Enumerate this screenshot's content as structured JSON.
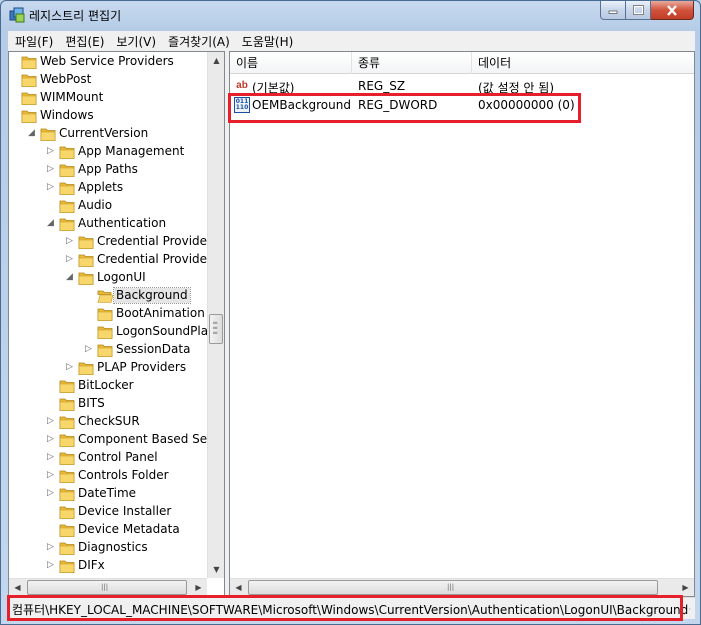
{
  "window": {
    "title": "레지스트리 편집기"
  },
  "menu": [
    "파일(F)",
    "편집(E)",
    "보기(V)",
    "즐겨찾기(A)",
    "도움말(H)"
  ],
  "tree": [
    {
      "label": "Web Service Providers",
      "indent": 0,
      "expander": "none",
      "selected": false
    },
    {
      "label": "WebPost",
      "indent": 0,
      "expander": "none",
      "selected": false
    },
    {
      "label": "WIMMount",
      "indent": 0,
      "expander": "none",
      "selected": false
    },
    {
      "label": "Windows",
      "indent": 0,
      "expander": "none",
      "selected": false
    },
    {
      "label": "CurrentVersion",
      "indent": 1,
      "expander": "open",
      "selected": false
    },
    {
      "label": "App Management",
      "indent": 2,
      "expander": "closed",
      "selected": false
    },
    {
      "label": "App Paths",
      "indent": 2,
      "expander": "closed",
      "selected": false
    },
    {
      "label": "Applets",
      "indent": 2,
      "expander": "closed",
      "selected": false
    },
    {
      "label": "Audio",
      "indent": 2,
      "expander": "none",
      "selected": false
    },
    {
      "label": "Authentication",
      "indent": 2,
      "expander": "open",
      "selected": false
    },
    {
      "label": "Credential Provider Fi",
      "indent": 3,
      "expander": "closed",
      "selected": false
    },
    {
      "label": "Credential Providers",
      "indent": 3,
      "expander": "closed",
      "selected": false
    },
    {
      "label": "LogonUI",
      "indent": 3,
      "expander": "open",
      "selected": false
    },
    {
      "label": "Background",
      "indent": 4,
      "expander": "none",
      "selected": true
    },
    {
      "label": "BootAnimation",
      "indent": 4,
      "expander": "none",
      "selected": false
    },
    {
      "label": "LogonSoundPlaye",
      "indent": 4,
      "expander": "none",
      "selected": false
    },
    {
      "label": "SessionData",
      "indent": 4,
      "expander": "closed",
      "selected": false
    },
    {
      "label": "PLAP Providers",
      "indent": 3,
      "expander": "closed",
      "selected": false
    },
    {
      "label": "BitLocker",
      "indent": 2,
      "expander": "none",
      "selected": false
    },
    {
      "label": "BITS",
      "indent": 2,
      "expander": "none",
      "selected": false
    },
    {
      "label": "CheckSUR",
      "indent": 2,
      "expander": "closed",
      "selected": false
    },
    {
      "label": "Component Based Servic",
      "indent": 2,
      "expander": "closed",
      "selected": false
    },
    {
      "label": "Control Panel",
      "indent": 2,
      "expander": "closed",
      "selected": false
    },
    {
      "label": "Controls Folder",
      "indent": 2,
      "expander": "closed",
      "selected": false
    },
    {
      "label": "DateTime",
      "indent": 2,
      "expander": "closed",
      "selected": false
    },
    {
      "label": "Device Installer",
      "indent": 2,
      "expander": "none",
      "selected": false
    },
    {
      "label": "Device Metadata",
      "indent": 2,
      "expander": "none",
      "selected": false
    },
    {
      "label": "Diagnostics",
      "indent": 2,
      "expander": "closed",
      "selected": false
    },
    {
      "label": "DIFx",
      "indent": 2,
      "expander": "closed",
      "selected": false
    }
  ],
  "list": {
    "columns": [
      "이름",
      "종류",
      "데이터"
    ],
    "rows": [
      {
        "icon": "string-value-icon",
        "icon_text": "ab",
        "name": "(기본값)",
        "type": "REG_SZ",
        "data": "(값 설정 안 됨)"
      },
      {
        "icon": "dword-value-icon",
        "icon_text": "011",
        "name": "OEMBackground",
        "type": "REG_DWORD",
        "data": "0x00000000 (0)"
      }
    ]
  },
  "statusbar": {
    "path": "컴퓨터\\HKEY_LOCAL_MACHINE\\SOFTWARE\\Microsoft\\Windows\\CurrentVersion\\Authentication\\LogonUI\\Background"
  },
  "scroll": {
    "tree_vertical_position": 0.53
  },
  "icons": {
    "folder": "folder-icon",
    "app": "regedit-app-icon"
  },
  "colors": {
    "highlight": "#e5202a",
    "folder": "#f2c84b"
  }
}
